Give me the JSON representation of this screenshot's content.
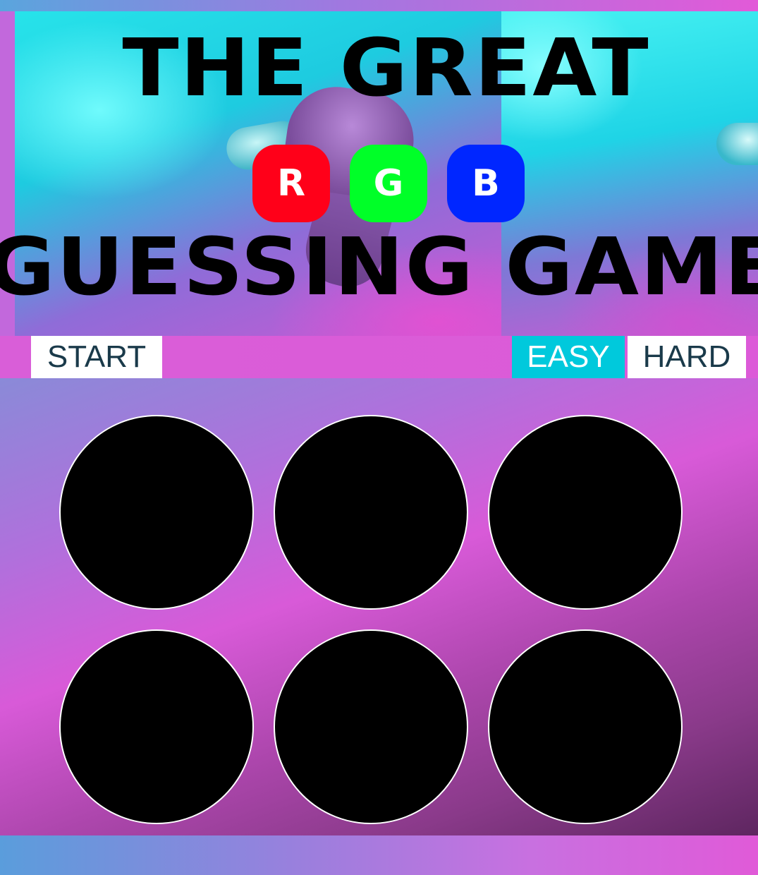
{
  "header": {
    "title_line_1": "THE GREAT",
    "title_line_2": "GUESSING GAME",
    "rgb_buttons": [
      {
        "label": "R",
        "color": "#ff0019"
      },
      {
        "label": "G",
        "color": "#00ff28"
      },
      {
        "label": "B",
        "color": "#0026ff"
      }
    ]
  },
  "controls": {
    "start_label": "START",
    "easy_label": "EASY",
    "hard_label": "HARD",
    "selected_mode": "EASY",
    "accent_color": "#00c9dc"
  },
  "board": {
    "circle_count": 6,
    "circle_color": "#000000",
    "circle_border_color": "#ffffff"
  }
}
